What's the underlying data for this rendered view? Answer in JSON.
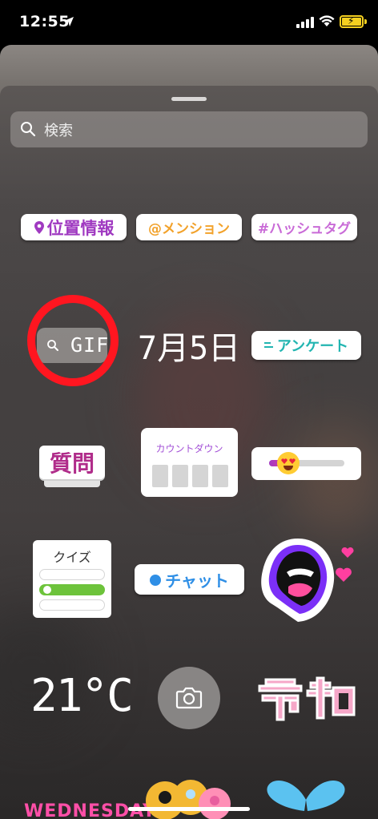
{
  "status_bar": {
    "time": "12:55",
    "location_icon": "location-arrow-icon",
    "signal_icon": "cellular-signal-icon",
    "wifi_icon": "wifi-icon",
    "battery_icon": "battery-charging-icon",
    "battery_color": "#f5d020"
  },
  "search": {
    "placeholder": "検索",
    "icon": "search-icon"
  },
  "stickers": {
    "location": "位置情報",
    "mention": "@メンション",
    "hashtag": "#ハッシュタグ",
    "gif": "GIF",
    "date": "7月5日",
    "poll": "アンケート",
    "questions": "質問",
    "countdown": "カウントダウン",
    "emoji_slider": "heart-eyes-emoji-slider",
    "quiz": "クイズ",
    "chat": "チャット",
    "mouth_sticker": "screaming-mouth-sticker",
    "temperature": "21°C",
    "reiwa": "令和",
    "weekday": "WEDNESDAY",
    "flowers": "flower-sticker",
    "butterfly": "butterfly-sticker"
  },
  "highlight": {
    "target": "gif",
    "color": "#ff1620"
  },
  "camera_button": "camera-icon"
}
